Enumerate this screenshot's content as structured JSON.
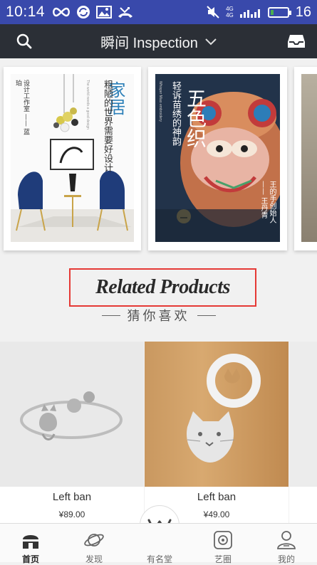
{
  "status_bar": {
    "time": "10:14",
    "battery_level": "16",
    "signal_4g_a": "4G",
    "signal_4g_b": "4G"
  },
  "header": {
    "title": "瞬间 Inspection"
  },
  "carousel": {
    "posters": [
      {
        "main": "家居",
        "sub": "粗陋的世界需要好设计",
        "side": "设计工作室 —— 蓝珀",
        "en": "The world needs a good design"
      },
      {
        "main": "五色织",
        "sub": "轻诉苗绣的神韵",
        "side": "王的手创始人 —— 王丹青",
        "en": "Whisper Miao embroidery"
      }
    ]
  },
  "section": {
    "title": "Related Products",
    "subtitle": "猜你喜欢"
  },
  "products": [
    {
      "name": "Left ban",
      "price": "¥89.00"
    },
    {
      "name": "Left ban",
      "price": "¥49.00"
    }
  ],
  "tabbar": {
    "items": [
      {
        "label": "首页"
      },
      {
        "label": "发现"
      },
      {
        "label": "有名堂"
      },
      {
        "label": "艺圈"
      },
      {
        "label": "我的"
      }
    ]
  }
}
